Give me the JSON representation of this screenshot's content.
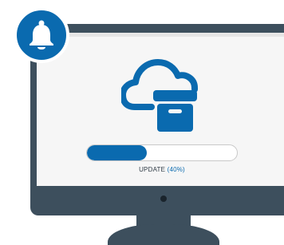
{
  "update": {
    "label": "UPDATE",
    "percent_text": "(40%)",
    "progress_fraction": 0.4
  },
  "colors": {
    "accent": "#0a6aaf",
    "monitor": "#3d4f5d",
    "screen": "#f6f6f6"
  },
  "icons": {
    "notification": "bell-icon",
    "status": "cloud-archive-icon"
  }
}
